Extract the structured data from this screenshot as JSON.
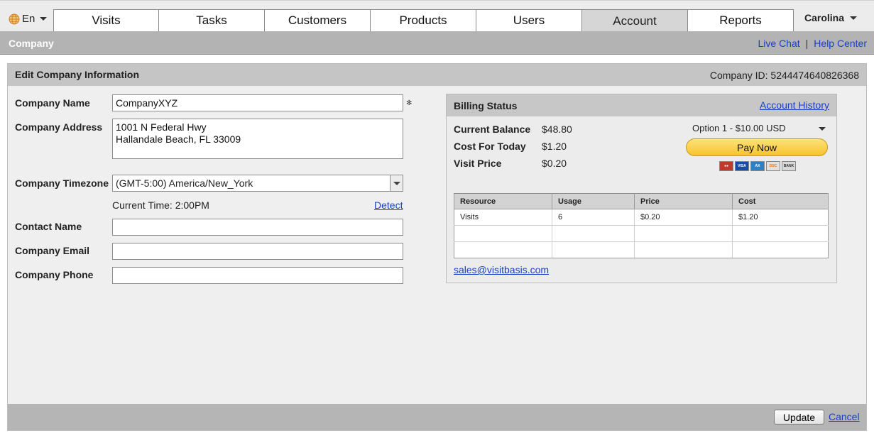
{
  "nav": {
    "language": "En",
    "tabs": [
      {
        "label": "Visits"
      },
      {
        "label": "Tasks"
      },
      {
        "label": "Customers"
      },
      {
        "label": "Products"
      },
      {
        "label": "Users"
      },
      {
        "label": "Account",
        "active": true
      },
      {
        "label": "Reports"
      }
    ],
    "user_name": "Carolina"
  },
  "subheader": {
    "section": "Company",
    "live_chat": "Live Chat",
    "separator": "|",
    "help_center": "Help Center"
  },
  "panel": {
    "title": "Edit Company Information",
    "company_id": "Company ID: 5244474640826368"
  },
  "form": {
    "company_name_label": "Company Name",
    "company_name_value": "CompanyXYZ",
    "required_mark": "✻",
    "company_address_label": "Company Address",
    "company_address_value": "1001 N Federal Hwy\nHallandale Beach, FL 33009",
    "company_timezone_label": "Company Timezone",
    "company_timezone_value": "(GMT-5:00) America/New_York",
    "current_time": "Current Time: 2:00PM",
    "detect_label": "Detect",
    "contact_name_label": "Contact Name",
    "contact_name_value": "",
    "company_email_label": "Company Email",
    "company_email_value": "",
    "company_phone_label": "Company Phone",
    "company_phone_value": ""
  },
  "billing": {
    "title": "Billing Status",
    "account_history": "Account History",
    "current_balance_label": "Current Balance",
    "current_balance_value": "$48.80",
    "cost_today_label": "Cost For Today",
    "cost_today_value": "$1.20",
    "visit_price_label": "Visit Price",
    "visit_price_value": "$0.20",
    "payment_option": "Option 1 - $10.00 USD",
    "pay_now": "Pay Now",
    "cards": [
      {
        "name": "mastercard-icon",
        "color": "#c0392b"
      },
      {
        "name": "visa-icon",
        "color": "#1a4aa8"
      },
      {
        "name": "amex-icon",
        "color": "#2f7fc4"
      },
      {
        "name": "discover-icon",
        "color": "#e0e0e0"
      },
      {
        "name": "bank-icon",
        "color": "#d8d8d8"
      }
    ],
    "table": {
      "headers": [
        "Resource",
        "Usage",
        "Price",
        "Cost"
      ],
      "rows": [
        [
          "Visits",
          "6",
          "$0.20",
          "$1.20"
        ],
        [
          "",
          "",
          "",
          ""
        ],
        [
          "",
          "",
          "",
          ""
        ]
      ]
    },
    "sales_email": "sales@visitbasis.com"
  },
  "footer": {
    "update": "Update",
    "cancel": "Cancel"
  },
  "colors": {
    "link": "#1a3ec9",
    "pay_button": "#f6c32d"
  }
}
